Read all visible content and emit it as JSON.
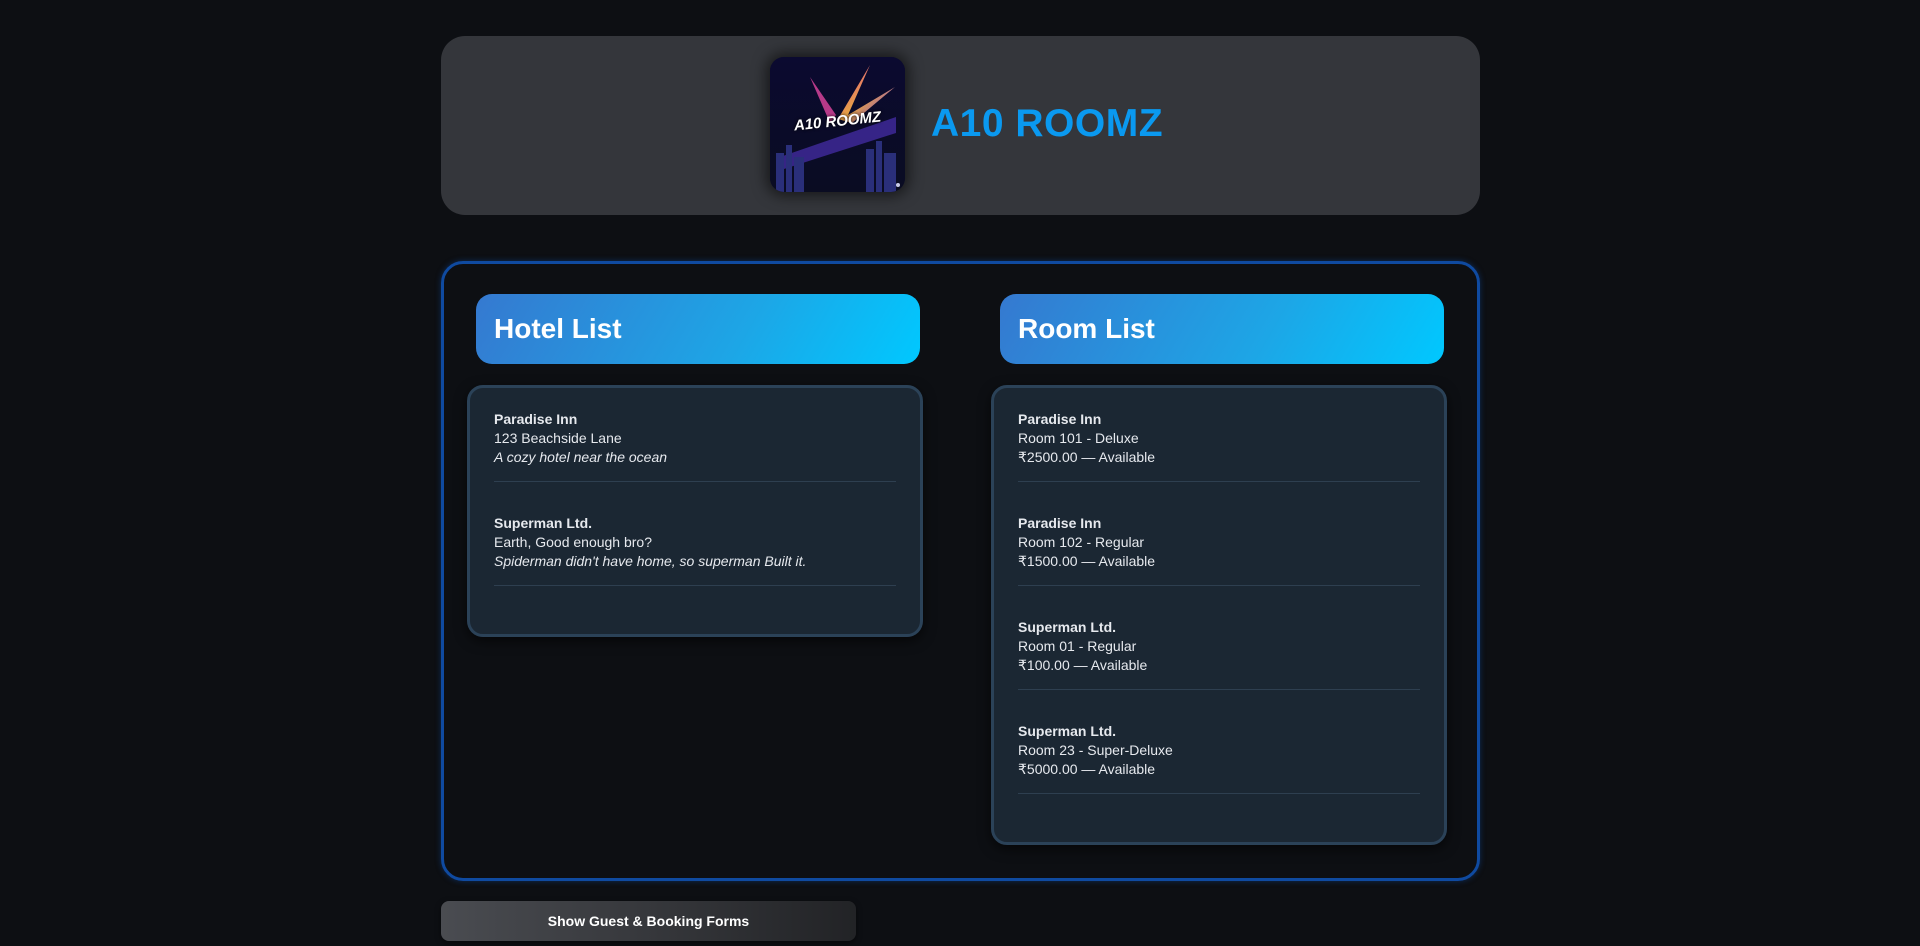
{
  "header": {
    "logo_text": "A10 ROOMZ",
    "brand_title": "A10 ROOMZ"
  },
  "colors": {
    "brand": "#0a99f0",
    "title_gradient_start": "#3579d0",
    "title_gradient_end": "#00c8ff",
    "panel_border": "#0f4aa0",
    "card_bg": "#1b2733"
  },
  "hotel_section": {
    "title": "Hotel List",
    "hotels": [
      {
        "name": "Paradise Inn",
        "address": "123 Beachside Lane",
        "description": "A cozy hotel near the ocean"
      },
      {
        "name": "Superman Ltd.",
        "address": "Earth, Good enough bro?",
        "description": "Spiderman didn't have home, so superman Built it."
      }
    ]
  },
  "room_section": {
    "title": "Room List",
    "rooms": [
      {
        "hotel": "Paradise Inn",
        "room": "Room 101 - Deluxe",
        "price_status": "₹2500.00 — Available"
      },
      {
        "hotel": "Paradise Inn",
        "room": "Room 102 - Regular",
        "price_status": "₹1500.00 — Available"
      },
      {
        "hotel": "Superman Ltd.",
        "room": "Room 01 - Regular",
        "price_status": "₹100.00 — Available"
      },
      {
        "hotel": "Superman Ltd.",
        "room": "Room 23 - Super-Deluxe",
        "price_status": "₹5000.00 — Available"
      }
    ]
  },
  "footer": {
    "toggle_forms_label": "Show Guest & Booking Forms"
  }
}
